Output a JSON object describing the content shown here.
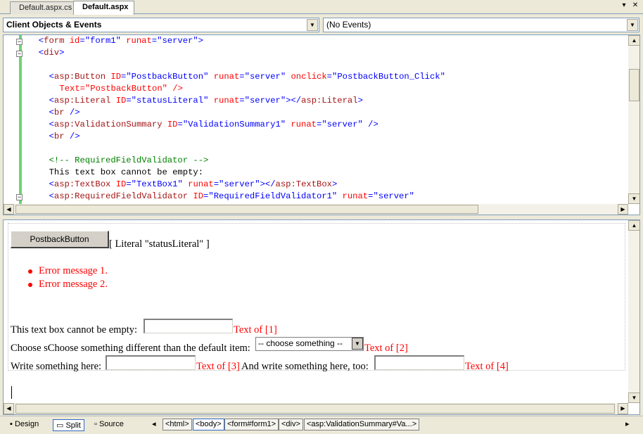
{
  "tabs": [
    {
      "label": "Default.aspx.cs",
      "active": false
    },
    {
      "label": "Default.aspx",
      "active": true
    }
  ],
  "tab_controls": {
    "dropdown": "▾",
    "close": "✕"
  },
  "object_dropdown": {
    "value": "Client Objects & Events"
  },
  "event_dropdown": {
    "value": "(No Events)"
  },
  "code_lines": [
    [
      "<form ",
      "id",
      "=\"form1\" ",
      "runat",
      "=\"server\">"
    ],
    [
      "<div>"
    ],
    [
      ""
    ],
    [
      "<asp:Button ",
      "ID",
      "=\"PostbackButton\" ",
      "runat",
      "=\"server\" ",
      "onclick",
      "=\"PostbackButton_Click\""
    ],
    [
      "Text",
      "=\"PostbackButton\" />"
    ],
    [
      "<asp:Literal ",
      "ID",
      "=\"statusLiteral\" ",
      "runat",
      "=\"server\"></asp:Literal>"
    ],
    [
      "<br />"
    ],
    [
      "<asp:ValidationSummary ",
      "ID",
      "=\"ValidationSummary1\" ",
      "runat",
      "=\"server\" />"
    ],
    [
      "<br />"
    ],
    [
      ""
    ],
    [
      "<!-- RequiredFieldValidator -->"
    ],
    [
      "This text box cannot be empty:"
    ],
    [
      "<asp:TextBox ",
      "ID",
      "=\"TextBox1\" ",
      "runat",
      "=\"server\"></asp:TextBox>"
    ],
    [
      "<asp:RequiredFieldValidator ",
      "ID",
      "=\"RequiredFieldValidator1\" ",
      "runat",
      "=\"server\""
    ]
  ],
  "design": {
    "postback_button_label": "PostbackButton",
    "literal_placeholder": "[ Literal \"statusLiteral\" ]",
    "error_messages": [
      "Error message 1.",
      "Error message 2."
    ],
    "row1_label": "This text box cannot be empty:",
    "row1_validator": "Text of [1]",
    "row2_label": "Choose sChoose something different than the default item:",
    "row2_select_value": "-- choose something --",
    "row2_validator": "Text of [2]",
    "row3_label": "Write something here:",
    "row3_validator": "Text of [3]",
    "row3_label2": "And write something here, too:",
    "row3_validator2": "Text of [4]"
  },
  "view_buttons": [
    {
      "label": "Design",
      "icon": "design-view-icon",
      "selected": false
    },
    {
      "label": "Split",
      "icon": "split-view-icon",
      "selected": true
    },
    {
      "label": "Source",
      "icon": "source-view-icon",
      "selected": false
    }
  ],
  "breadcrumbs": [
    {
      "label": "<html>",
      "current": false
    },
    {
      "label": "<body>",
      "current": true
    },
    {
      "label": "<form#form1>",
      "current": false
    },
    {
      "label": "<div>",
      "current": false
    },
    {
      "label": "<asp:ValidationSummary#Va...>",
      "current": false
    }
  ],
  "colors": {
    "tag": "#a31515",
    "attribute": "#ff0000",
    "value": "#0000ff",
    "comment": "#008000",
    "validator_text": "#ff0000",
    "change_bar": "#6fd36f"
  },
  "arrows": {
    "up": "▲",
    "down": "▼",
    "left": "◀",
    "right": "▶",
    "nav_left": "◂",
    "nav_right": "▸"
  }
}
